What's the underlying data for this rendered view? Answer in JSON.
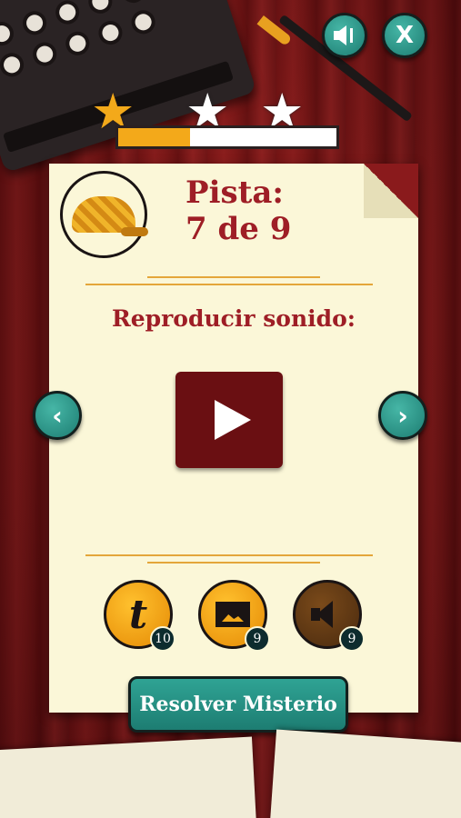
{
  "top_bar": {
    "sound_icon": "speaker-icon",
    "close_label": "X"
  },
  "stars": {
    "earned": 1,
    "total": 3,
    "progress_fraction": 0.33
  },
  "clue": {
    "label": "Pista:",
    "counter": "7 de 9"
  },
  "prompt": {
    "text": "Reproducir sonido:"
  },
  "hints": [
    {
      "icon": "text-hint-icon",
      "glyph": "t",
      "count": "10",
      "state": "active"
    },
    {
      "icon": "image-hint-icon",
      "count": "9",
      "state": "active"
    },
    {
      "icon": "sound-hint-icon",
      "count": "9",
      "state": "used"
    }
  ],
  "solve_button": {
    "label": "Resolver Misterio"
  },
  "nav": {
    "prev_glyph": "‹",
    "next_glyph": "›"
  },
  "colors": {
    "accent_teal": "#1d7d72",
    "gold": "#f3a91a",
    "title_red": "#9e1e26",
    "paper": "#fbf7d8"
  }
}
